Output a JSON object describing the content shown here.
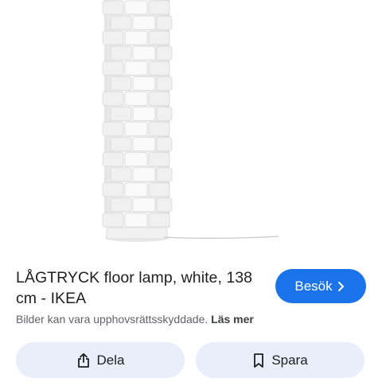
{
  "result": {
    "title": "LÅGTRYCK floor lamp, white, 138 cm - IKEA",
    "visit_label": "Besök",
    "copyright_notice": "Bilder kan vara upphovsrättsskyddade.",
    "read_more_label": "Läs mer"
  },
  "actions": {
    "share_label": "Dela",
    "save_label": "Spara"
  },
  "icons": {
    "visit": "chevron-right-icon",
    "share": "share-icon",
    "save": "bookmark-icon"
  },
  "colors": {
    "accent": "#1a73e8",
    "action_bg": "#e8eefa"
  }
}
